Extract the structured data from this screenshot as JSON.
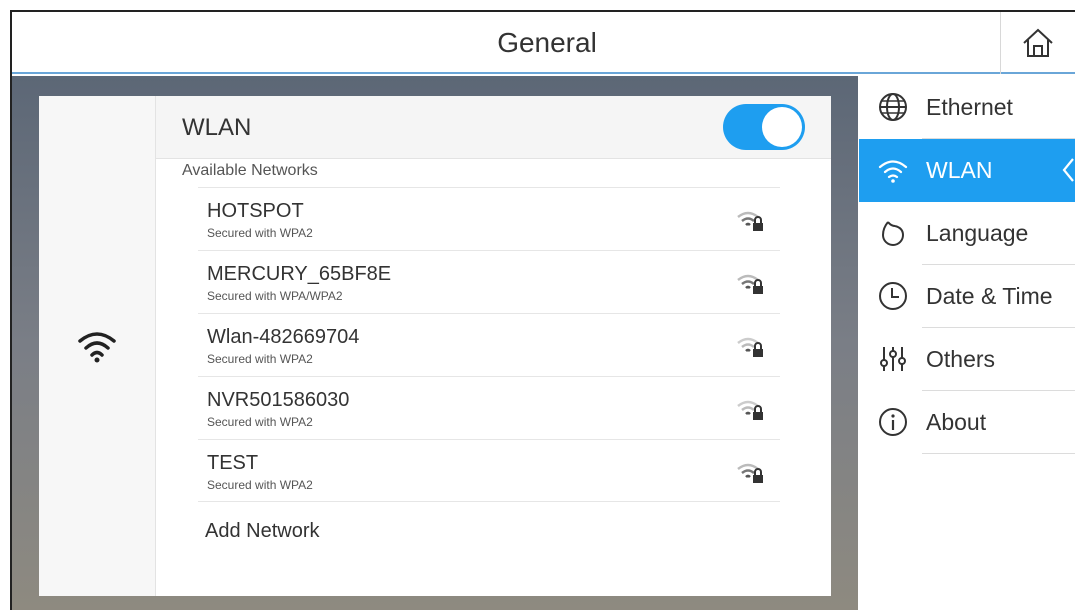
{
  "header": {
    "title": "General"
  },
  "wlan": {
    "title": "WLAN",
    "enabled": true,
    "available_label": "Available Networks",
    "networks": [
      {
        "name": "HOTSPOT",
        "security": "Secured with WPA2"
      },
      {
        "name": "MERCURY_65BF8E",
        "security": "Secured with WPA/WPA2"
      },
      {
        "name": "Wlan-482669704",
        "security": "Secured with WPA2"
      },
      {
        "name": "NVR501586030",
        "security": "Secured with WPA2"
      },
      {
        "name": "TEST",
        "security": "Secured with WPA2"
      }
    ],
    "add_network": "Add Network"
  },
  "sidebar": {
    "items": [
      {
        "label": "Ethernet",
        "icon": "globe-icon"
      },
      {
        "label": "WLAN",
        "icon": "wifi-icon",
        "active": true
      },
      {
        "label": "Language",
        "icon": "language-icon"
      },
      {
        "label": "Date & Time",
        "icon": "clock-icon"
      },
      {
        "label": "Others",
        "icon": "sliders-icon"
      },
      {
        "label": "About",
        "icon": "info-icon"
      }
    ]
  },
  "colors": {
    "accent": "#1e9ef0",
    "header_underline": "#6aa6d8"
  }
}
